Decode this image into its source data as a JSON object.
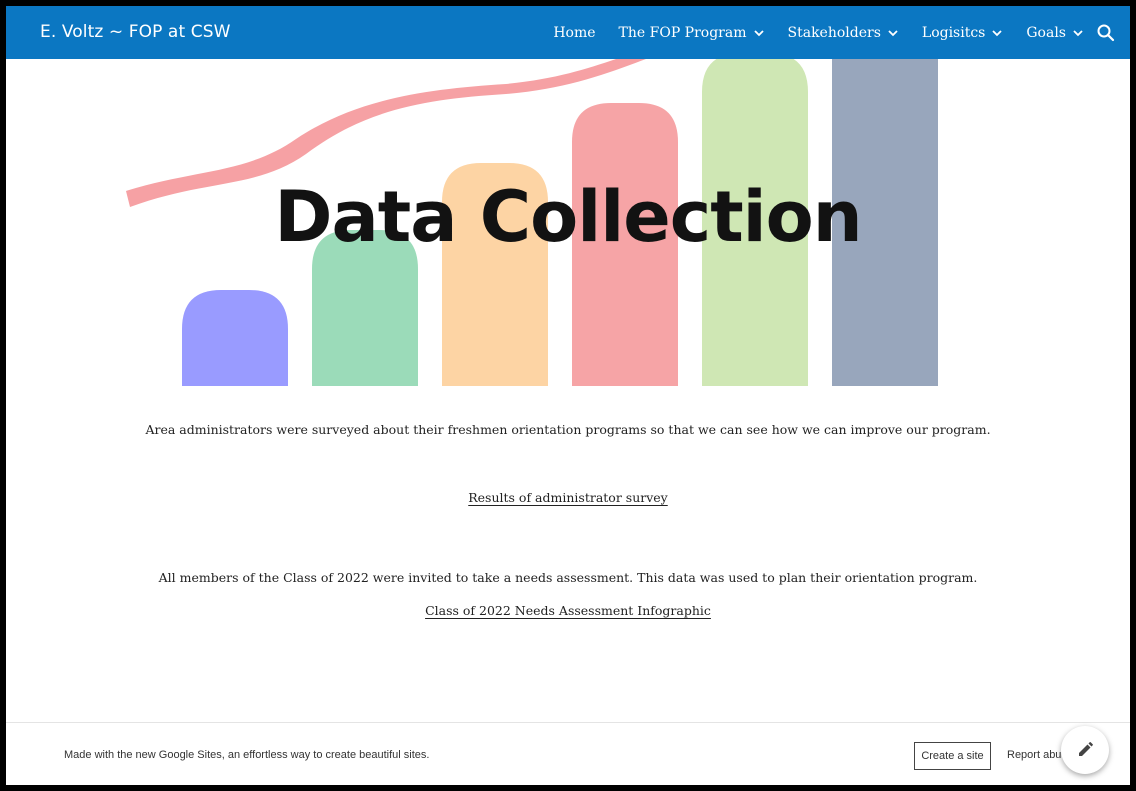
{
  "header": {
    "site_title": "E. Voltz ~ FOP at CSW",
    "nav": [
      {
        "label": "Home",
        "has_dropdown": false
      },
      {
        "label": "The FOP Program",
        "has_dropdown": true
      },
      {
        "label": "Stakeholders",
        "has_dropdown": true
      },
      {
        "label": "Logisitcs",
        "has_dropdown": true
      },
      {
        "label": "Goals",
        "has_dropdown": true
      }
    ],
    "search_icon": "search-icon"
  },
  "hero": {
    "title": "Data Collection",
    "colors": {
      "ribbon": "#f6a1a4",
      "bars": [
        "#999bff",
        "#9bdbb9",
        "#fdd4a4",
        "#f6a4a6",
        "#cfe7b4",
        "#98a6bc"
      ]
    }
  },
  "main": {
    "paragraph1": "Area administrators were surveyed about their freshmen orientation programs so that we can see how we can improve our program.",
    "link1": "Results of administrator survey",
    "paragraph2": "All members of the Class of 2022 were invited to take a needs assessment. This data was used to plan their orientation program.",
    "link2": "Class of 2022 Needs Assessment Infographic"
  },
  "footer": {
    "made_with": "Made with the new Google Sites, an effortless way to create beautiful sites.",
    "create_site": "Create a site",
    "report_abuse": "Report abu",
    "edit_icon": "pencil-icon"
  },
  "colors": {
    "header_bg": "#0b77c2",
    "text": "#222222"
  }
}
